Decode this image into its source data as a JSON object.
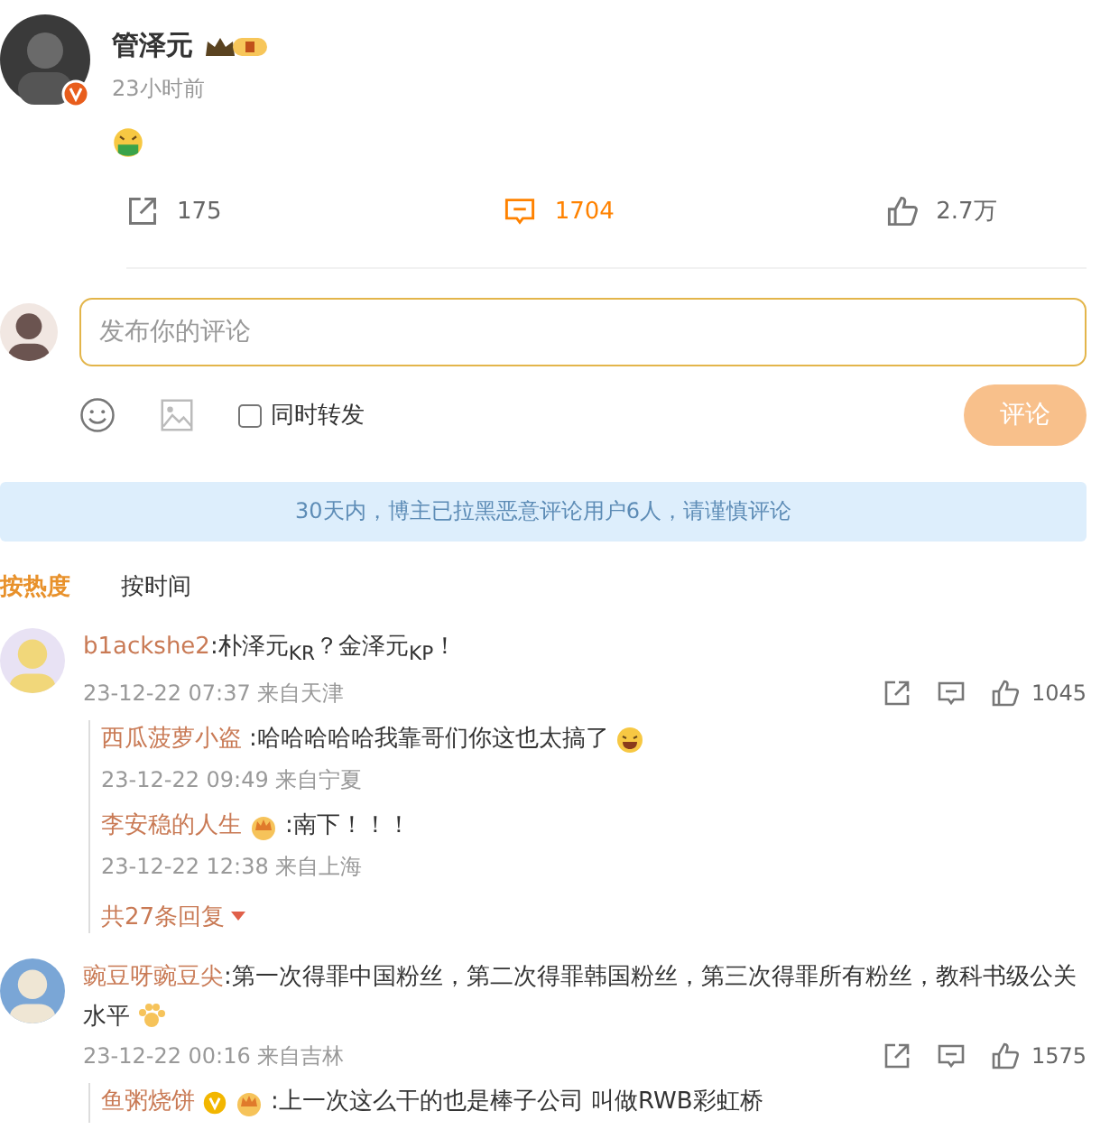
{
  "post": {
    "author": "管泽元",
    "time": "23小时前",
    "stats": [
      {
        "kind": "share",
        "count": "175",
        "selected": false
      },
      {
        "kind": "comment",
        "count": "1704",
        "selected": true
      },
      {
        "kind": "like",
        "count": "2.7万",
        "selected": false
      }
    ]
  },
  "composer": {
    "placeholder": "发布你的评论",
    "repost_label": "同时转发",
    "repost_checked": false,
    "submit": "评论",
    "submit_disabled": true
  },
  "notice": "30天内，博主已拉黑恶意评论用户6人，请谨慎评论",
  "sort_tabs": [
    {
      "label": "按热度",
      "selected": true
    },
    {
      "label": "按时间",
      "selected": false
    }
  ],
  "comments": [
    {
      "user": "b1ackshe2",
      "text": ":朴泽元$_{KR}$？金泽元$_{KP}$！",
      "meta": "23-12-22 07:37 来自天津",
      "likes": "1045",
      "replies": [
        {
          "user": "西瓜菠萝小盗",
          "text": ":哈哈哈哈哈我靠哥们你这也太搞了",
          "laugh_emoji": true,
          "meta": "23-12-22 09:49 来自宁夏"
        },
        {
          "user": "李安稳的人生",
          "crown_badge": true,
          "text": ":南下！！！",
          "meta": "23-12-22 12:38 来自上海"
        }
      ],
      "more": "共27条回复"
    },
    {
      "user": "豌豆呀豌豆尖",
      "text": ":第一次得罪中国粉丝，第二次得罪韩国粉丝，第三次得罪所有粉丝，教科书级公关水平",
      "paw_emoji": true,
      "meta": "23-12-22 00:16 来自吉林",
      "likes": "1575",
      "replies": [
        {
          "user": "鱼粥烧饼",
          "verified_badge": true,
          "crown_badge": true,
          "text": ":上一次这么干的也是棒子公司 叫做RWB彩虹桥"
        }
      ]
    }
  ]
}
